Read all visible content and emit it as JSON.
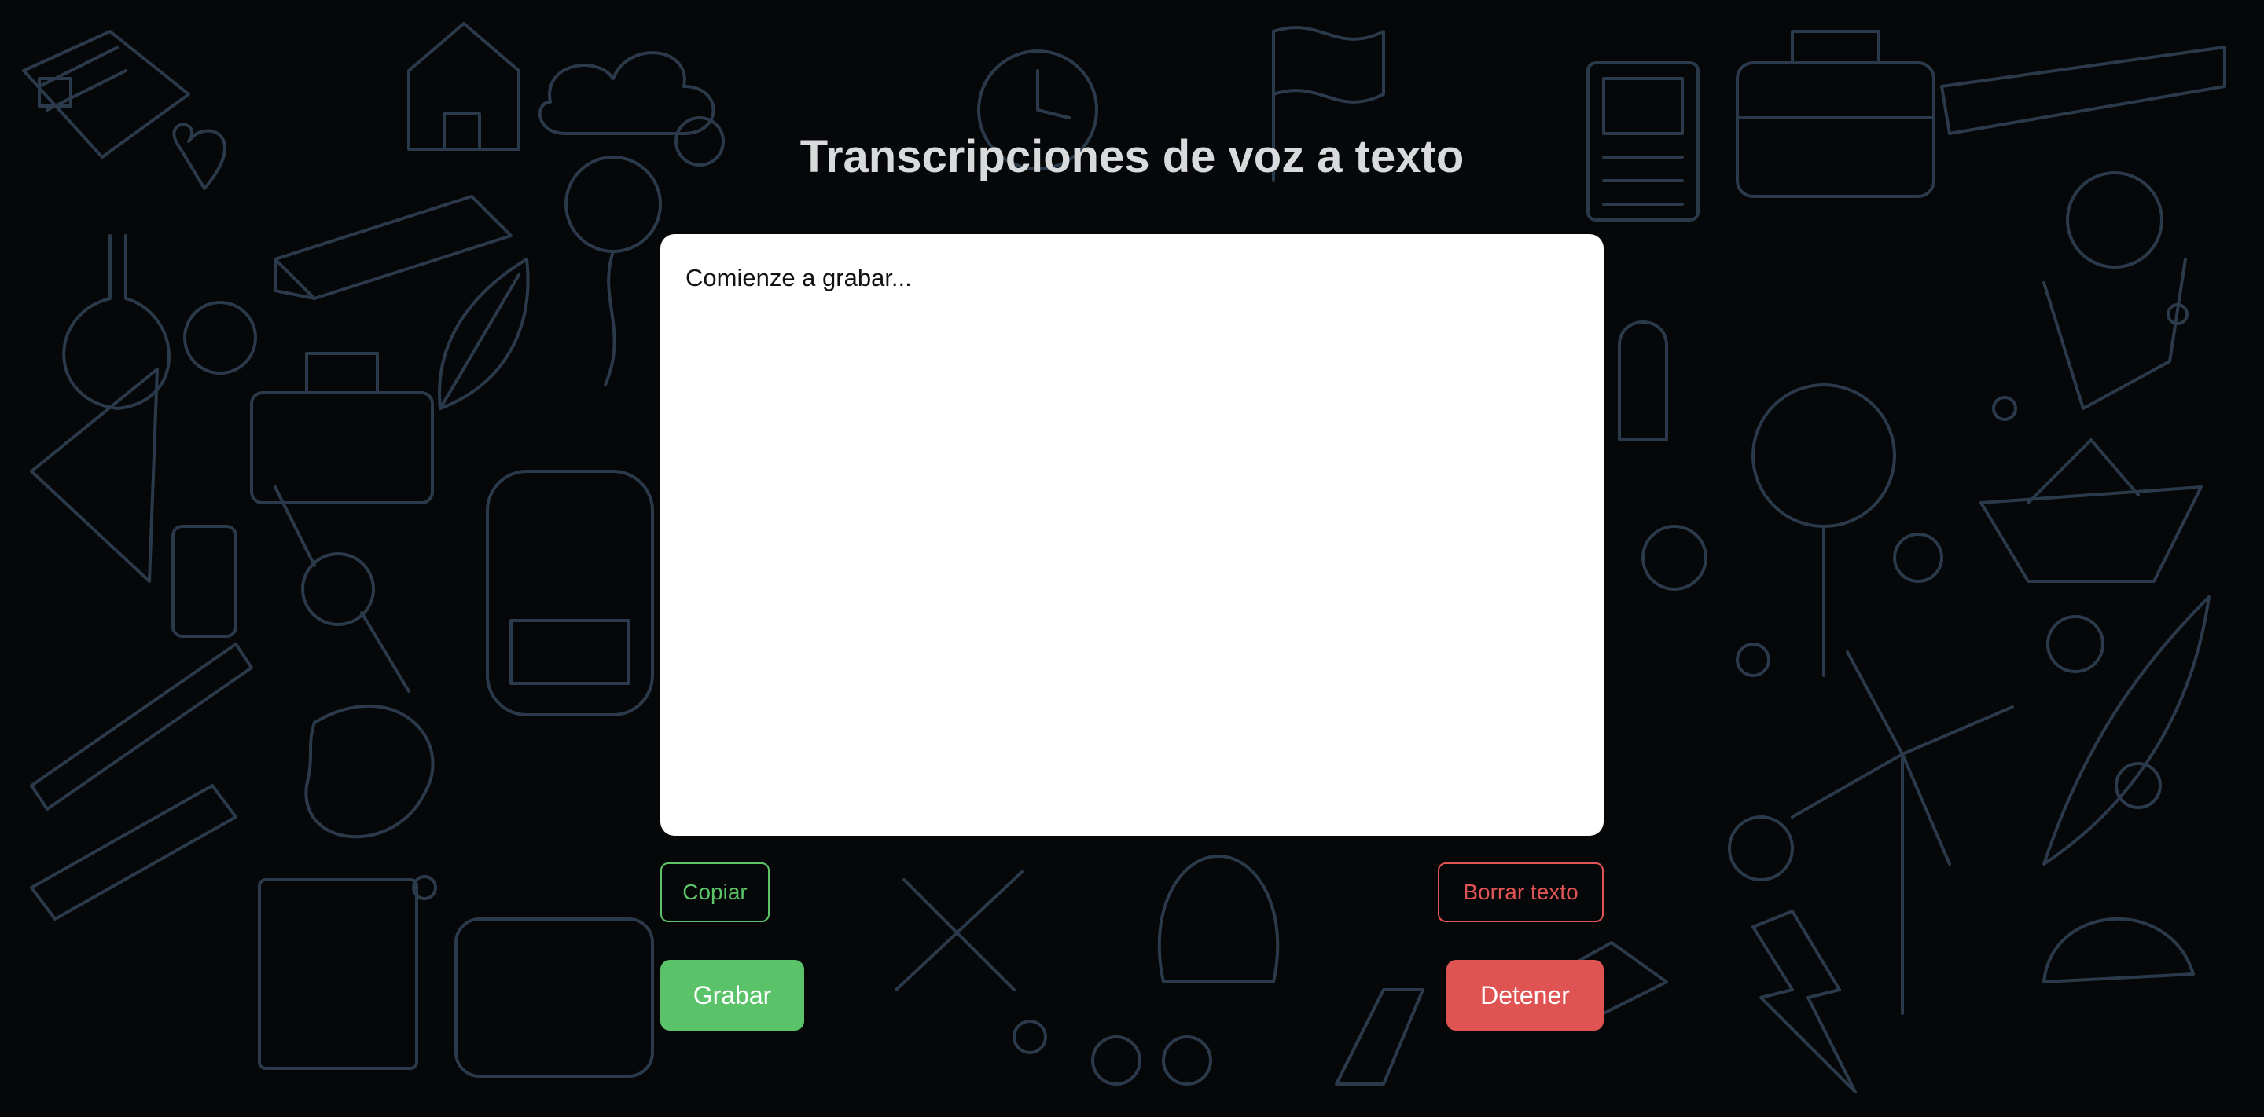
{
  "header": {
    "title": "Transcripciones de voz a texto"
  },
  "transcript": {
    "text": "Comienze a grabar..."
  },
  "actions": {
    "copy_label": "Copiar",
    "clear_label": "Borrar texto",
    "record_label": "Grabar",
    "stop_label": "Detener"
  },
  "colors": {
    "background": "#060708",
    "doodle_stroke": "#2b3a4a",
    "title": "#d9dadb",
    "green": "#5ac36a",
    "red": "#df5353"
  }
}
